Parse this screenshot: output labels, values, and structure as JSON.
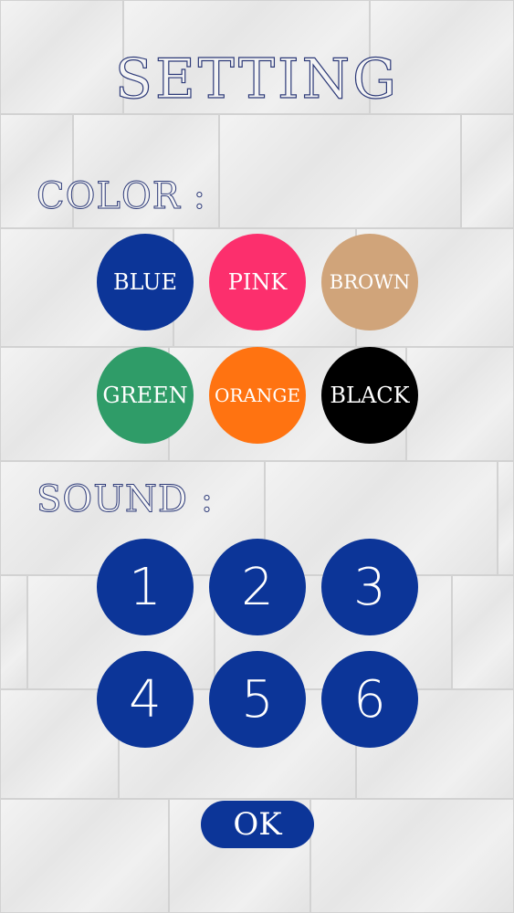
{
  "title": "SETTING",
  "color_section": {
    "label": "COLOR :",
    "options": [
      {
        "label": "BLUE",
        "color": "#0c3598"
      },
      {
        "label": "PINK",
        "color": "#fc2f6d"
      },
      {
        "label": "BROWN",
        "color": "#d0a47a"
      },
      {
        "label": "GREEN",
        "color": "#2f9c68"
      },
      {
        "label": "ORANGE",
        "color": "#ff7311"
      },
      {
        "label": "BLACK",
        "color": "#000000"
      }
    ]
  },
  "sound_section": {
    "label": "SOUND :",
    "options": [
      {
        "label": "1"
      },
      {
        "label": "2"
      },
      {
        "label": "3"
      },
      {
        "label": "4"
      },
      {
        "label": "5"
      },
      {
        "label": "6"
      }
    ]
  },
  "ok_label": "OK"
}
